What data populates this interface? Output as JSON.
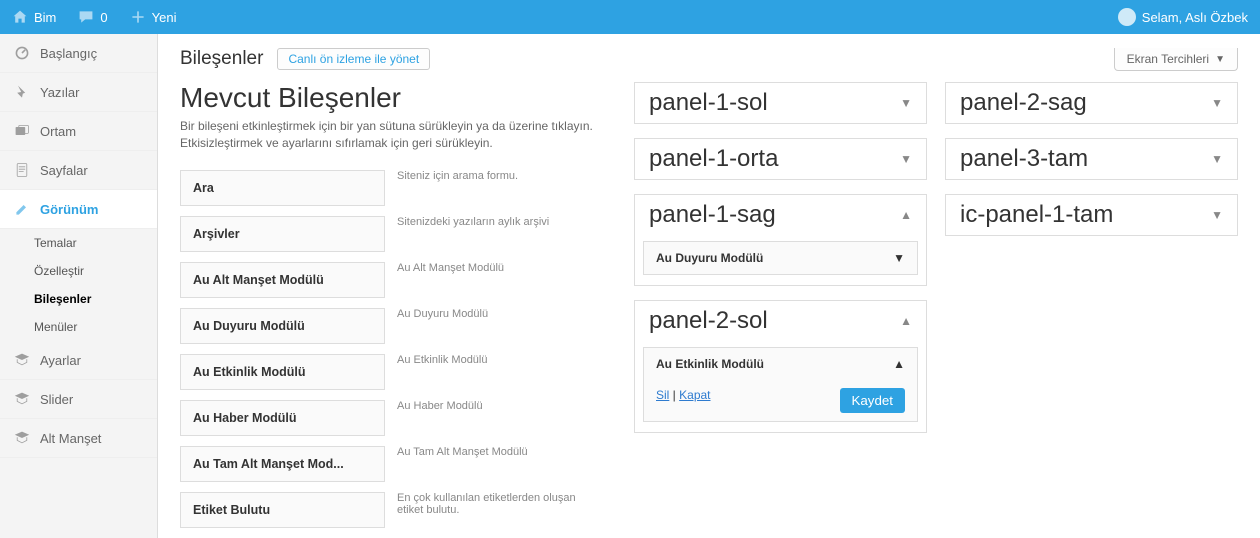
{
  "topbar": {
    "site": "Bim",
    "comments": "0",
    "new": "Yeni",
    "greeting": "Selam, Aslı Özbek"
  },
  "sidebar": {
    "items": [
      {
        "label": "Başlangıç",
        "icon": "dash"
      },
      {
        "label": "Yazılar",
        "icon": "pin"
      },
      {
        "label": "Ortam",
        "icon": "media"
      },
      {
        "label": "Sayfalar",
        "icon": "page"
      },
      {
        "label": "Görünüm",
        "icon": "brush",
        "current": true
      },
      {
        "label": "Ayarlar",
        "icon": "grad"
      },
      {
        "label": "Slider",
        "icon": "grad"
      },
      {
        "label": "Alt Manşet",
        "icon": "grad"
      }
    ],
    "subs": [
      {
        "label": "Temalar"
      },
      {
        "label": "Özelleştir"
      },
      {
        "label": "Bileşenler",
        "current": true
      },
      {
        "label": "Menüler"
      }
    ]
  },
  "screen_options": "Ekran Tercihleri",
  "page": {
    "title": "Bileşenler",
    "live_preview": "Canlı ön izleme ile yönet",
    "available_title": "Mevcut Bileşenler",
    "available_desc": "Bir bileşeni etkinleştirmek için bir yan sütuna sürükleyin ya da üzerine tıklayın. Etkisizleştirmek ve ayarlarını sıfırlamak için geri sürükleyin."
  },
  "available": [
    {
      "title": "Ara",
      "desc": "Siteniz için arama formu."
    },
    {
      "title": "Arşivler",
      "desc": "Sitenizdeki yazıların aylık arşivi"
    },
    {
      "title": "Au Alt Manşet Modülü",
      "desc": "Au Alt Manşet Modülü"
    },
    {
      "title": "Au Duyuru Modülü",
      "desc": "Au Duyuru Modülü"
    },
    {
      "title": "Au Etkinlik Modülü",
      "desc": "Au Etkinlik Modülü"
    },
    {
      "title": "Au Haber Modülü",
      "desc": "Au Haber Modülü"
    },
    {
      "title": "Au Tam Alt Manşet Mod...",
      "desc": "Au Tam Alt Manşet Modülü"
    },
    {
      "title": "Etiket Bulutu",
      "desc": "En çok kullanılan etiketlerden oluşan etiket bulutu."
    }
  ],
  "panels_left": [
    {
      "name": "panel-1-sol",
      "open": false
    },
    {
      "name": "panel-1-orta",
      "open": false
    },
    {
      "name": "panel-1-sag",
      "open": true,
      "widgets": [
        {
          "title": "Au Duyuru Modülü",
          "open": false
        }
      ]
    },
    {
      "name": "panel-2-sol",
      "open": true,
      "widgets": [
        {
          "title": "Au Etkinlik Modülü",
          "open": true
        }
      ]
    }
  ],
  "panels_right": [
    {
      "name": "panel-2-sag",
      "open": false
    },
    {
      "name": "panel-3-tam",
      "open": false
    },
    {
      "name": "ic-panel-1-tam",
      "open": false
    }
  ],
  "widget_actions": {
    "delete": "Sil",
    "close": "Kapat",
    "sep": " | ",
    "save": "Kaydet"
  }
}
